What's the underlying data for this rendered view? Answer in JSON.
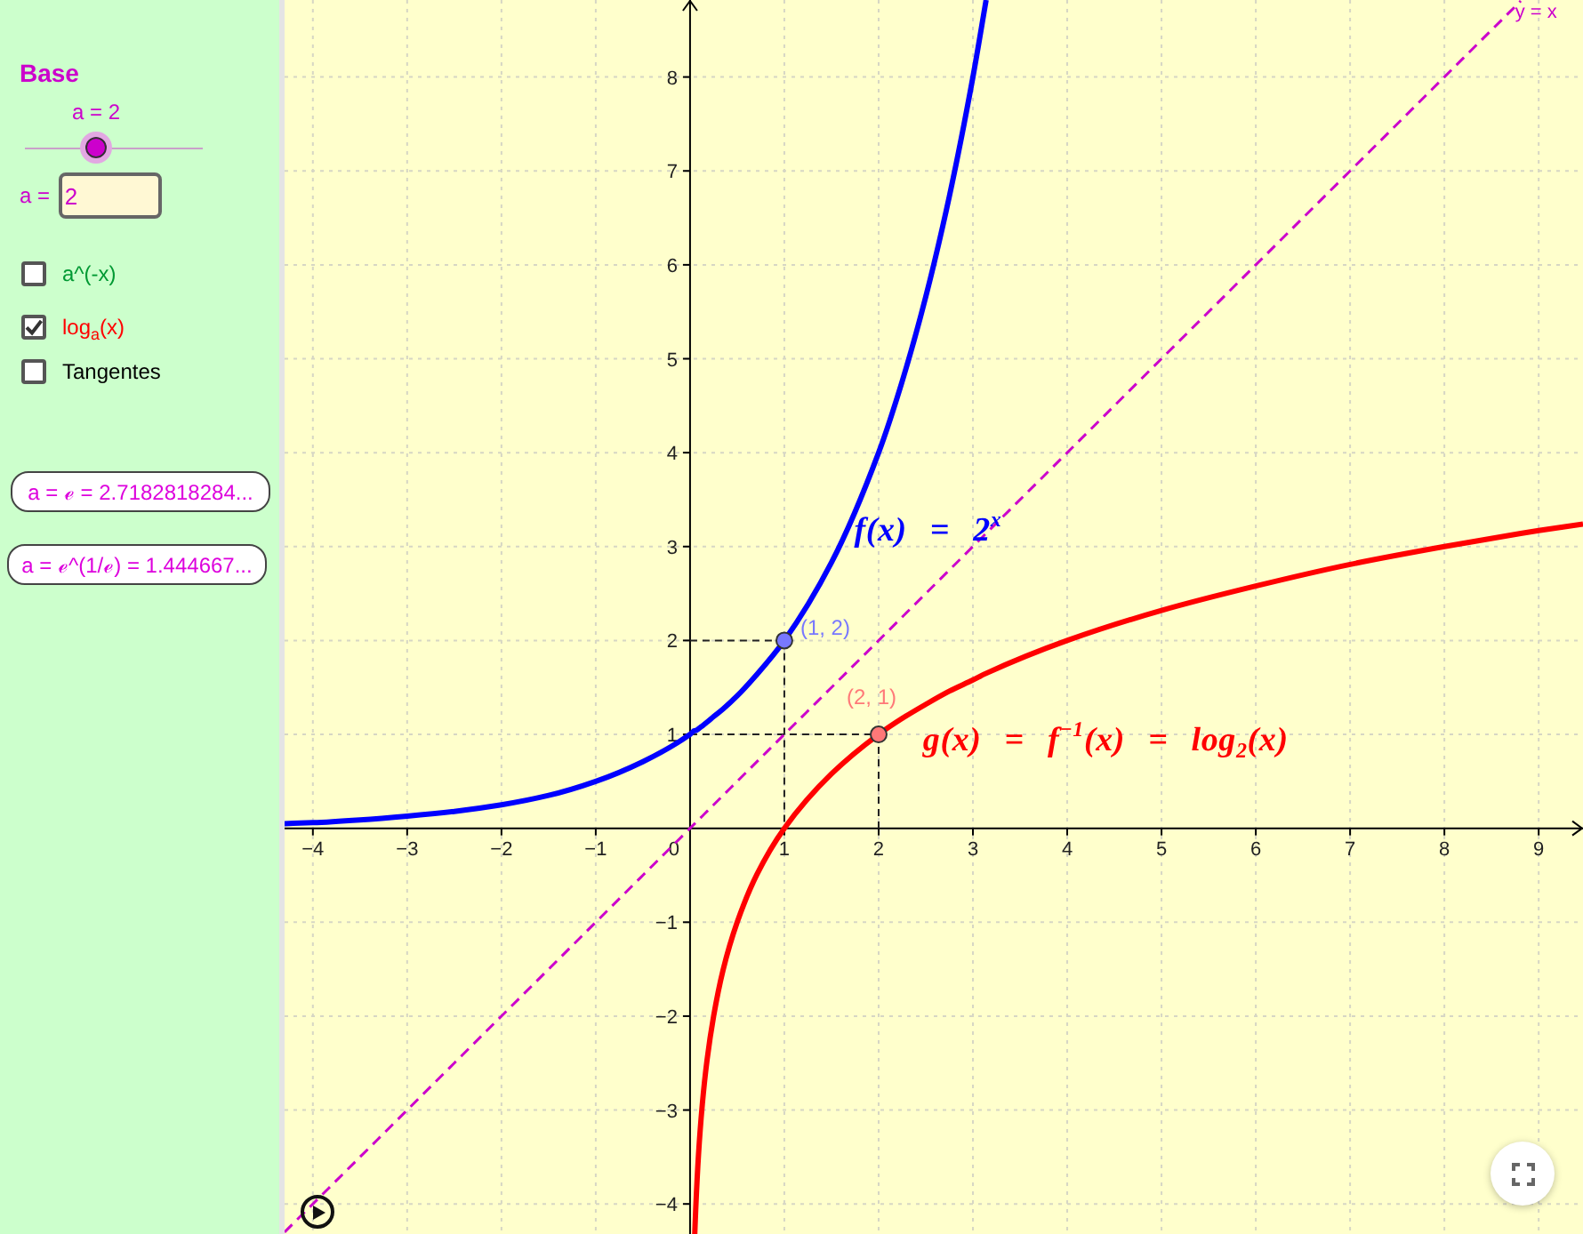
{
  "sidebar": {
    "title": "Base",
    "slider": {
      "label": "a = 2",
      "level": 0.4
    },
    "input": {
      "label": "a =",
      "value": "2"
    },
    "checkboxes": [
      {
        "label": "a^(-x)",
        "checked": false,
        "color": "#009933"
      },
      {
        "label": "log$_{a}$(x)",
        "checked": true,
        "color": "#ff0000"
      },
      {
        "label": "Tangentes",
        "checked": false,
        "color": "#000000"
      }
    ],
    "buttons": [
      {
        "label": "a = ℯ = 2.7182818284..."
      },
      {
        "label": "a = ℯ^(1/ℯ) = 1.444667..."
      }
    ]
  },
  "graph": {
    "chart_data": {
      "type": "line",
      "grid": true,
      "xlim": [
        -4.3,
        9.47
      ],
      "ylim": [
        -4.32,
        8.82
      ],
      "xticks": [
        {
          "value": -4,
          "label": "−4"
        },
        {
          "value": -3,
          "label": "−3"
        },
        {
          "value": -2,
          "label": "−2"
        },
        {
          "value": -1,
          "label": "−1"
        },
        {
          "value": 0,
          "label": "0"
        },
        {
          "value": 1,
          "label": "1"
        },
        {
          "value": 2,
          "label": "2"
        },
        {
          "value": 3,
          "label": "3"
        },
        {
          "value": 4,
          "label": "4"
        },
        {
          "value": 5,
          "label": "5"
        },
        {
          "value": 6,
          "label": "6"
        },
        {
          "value": 7,
          "label": "7"
        },
        {
          "value": 8,
          "label": "8"
        },
        {
          "value": 9,
          "label": "9"
        }
      ],
      "yticks": [
        {
          "value": -4,
          "label": "−4"
        },
        {
          "value": -3,
          "label": "−3"
        },
        {
          "value": -2,
          "label": "−2"
        },
        {
          "value": -1,
          "label": "−1"
        },
        {
          "value": 1,
          "label": "1"
        },
        {
          "value": 2,
          "label": "2"
        },
        {
          "value": 3,
          "label": "3"
        },
        {
          "value": 4,
          "label": "4"
        },
        {
          "value": 5,
          "label": "5"
        },
        {
          "value": 6,
          "label": "6"
        },
        {
          "value": 7,
          "label": "7"
        },
        {
          "value": 8,
          "label": "8"
        }
      ],
      "x": [
        -4.3,
        -4,
        -3.5,
        -3,
        -2.5,
        -2,
        -1.5,
        -1,
        -0.5,
        0,
        0.05,
        0.06,
        0.09,
        0.13,
        0.18,
        0.25,
        0.35,
        0.5,
        0.71,
        1,
        1.5,
        2,
        2.25,
        2.5,
        2.75,
        3,
        3.14,
        4,
        5,
        6,
        7,
        8,
        8.81,
        9,
        9.47
      ],
      "series": [
        {
          "name": "f(x) = 2$^{x}$",
          "color": "#0000ff",
          "line_style": "solid",
          "values": [
            0.05,
            0.06,
            0.09,
            0.13,
            0.18,
            0.25,
            0.35,
            0.5,
            0.71,
            1,
            1.04,
            1.04,
            1.06,
            1.09,
            1.13,
            1.19,
            1.27,
            1.41,
            1.64,
            2,
            2.83,
            4,
            4.76,
            5.66,
            6.73,
            8,
            8.82,
            null,
            null,
            null,
            null,
            null,
            null,
            null,
            null
          ]
        },
        {
          "name": "g(x) = f$^{−1}$(x) = log$_{2}$(x)",
          "color": "#ff0000",
          "line_style": "solid",
          "values": [
            null,
            null,
            null,
            null,
            null,
            null,
            null,
            null,
            null,
            null,
            -4.32,
            -4.06,
            -3.47,
            -2.94,
            -2.47,
            -2,
            -1.51,
            -1,
            -0.49,
            0,
            0.58,
            1,
            1.17,
            1.32,
            1.46,
            1.58,
            1.65,
            2,
            2.32,
            2.58,
            2.81,
            3,
            3.14,
            3.17,
            3.24
          ]
        },
        {
          "name": "y = x",
          "color": "#cc00cc",
          "line_style": "dashed",
          "values": [
            -4.3,
            -4,
            -3.5,
            -3,
            -2.5,
            -2,
            -1.5,
            -1,
            -0.5,
            0,
            0.05,
            0.06,
            0.09,
            0.13,
            0.18,
            0.25,
            0.35,
            0.5,
            0.71,
            1,
            1.5,
            2,
            2.25,
            2.5,
            2.75,
            3,
            3.14,
            4,
            5,
            6,
            7,
            8,
            8.81,
            null,
            null
          ]
        }
      ],
      "annotations": [
        {
          "x": 1,
          "y": 2,
          "text": "(1, 2)"
        },
        {
          "x": 2,
          "y": 1,
          "text": "(2, 1)"
        }
      ]
    }
  }
}
